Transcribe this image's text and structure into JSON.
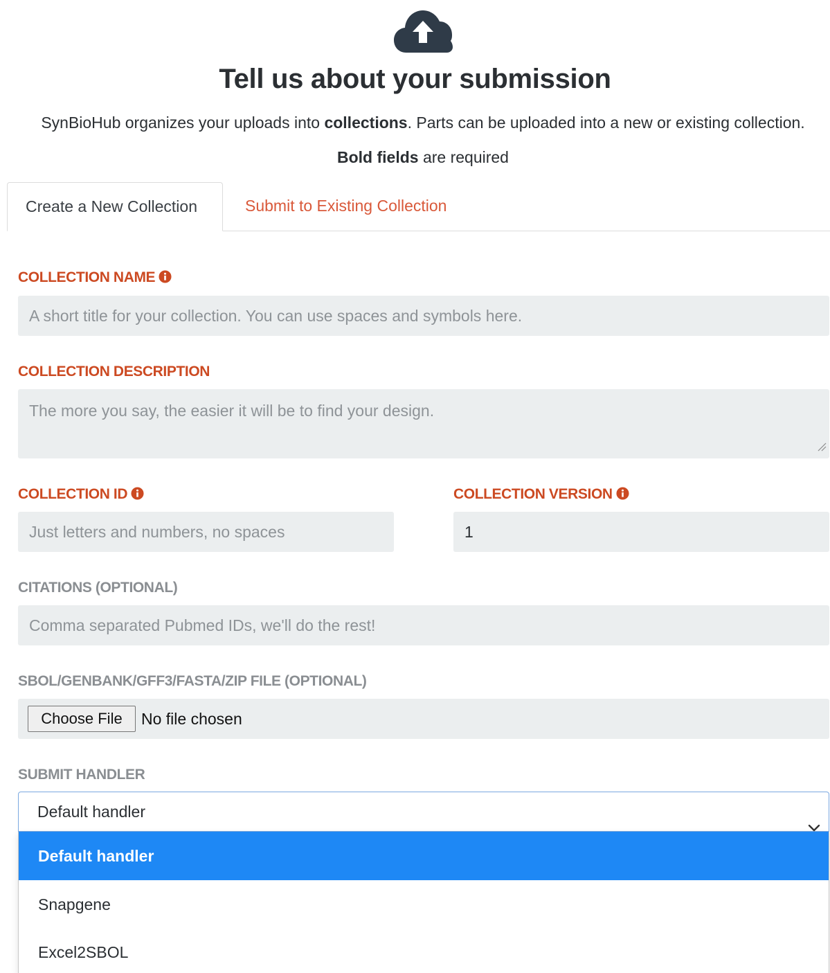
{
  "header": {
    "icon": "cloud-upload-icon",
    "title": "Tell us about your submission",
    "intro_prefix": "SynBioHub organizes your uploads into ",
    "intro_bold": "collections",
    "intro_suffix": ". Parts can be uploaded into a new or existing collection.",
    "required_bold": "Bold fields",
    "required_suffix": " are required"
  },
  "tabs": [
    {
      "label": "Create a New Collection",
      "active": true
    },
    {
      "label": "Submit to Existing Collection",
      "active": false
    }
  ],
  "form": {
    "collection_name": {
      "label": "COLLECTION NAME",
      "placeholder": "A short title for your collection.  You can use spaces and symbols here.",
      "info_icon": "info-circle-icon"
    },
    "collection_description": {
      "label": "COLLECTION DESCRIPTION",
      "placeholder": "The more you say, the easier it will be to find your design."
    },
    "collection_id": {
      "label": "COLLECTION ID",
      "placeholder": "Just letters and numbers, no spaces",
      "info_icon": "info-circle-icon"
    },
    "collection_version": {
      "label": "COLLECTION VERSION",
      "value": "1",
      "info_icon": "info-circle-icon"
    },
    "citations": {
      "label": "CITATIONS (OPTIONAL)",
      "placeholder": "Comma separated Pubmed IDs, we'll do the rest!"
    },
    "file": {
      "label": "SBOL/GENBANK/GFF3/FASTA/ZIP FILE (OPTIONAL)",
      "button_label": "Choose File",
      "status": "No file chosen"
    },
    "submit_handler": {
      "label": "SUBMIT HANDLER",
      "selected": "Default handler",
      "options": [
        "Default handler",
        "Snapgene",
        "Excel2SBOL"
      ]
    }
  },
  "colors": {
    "accent": "#cc4a22",
    "tab_link": "#d9593a",
    "dark_text": "#2b2f33",
    "field_bg": "#ebeeef",
    "selected_option": "#1e88f5"
  }
}
